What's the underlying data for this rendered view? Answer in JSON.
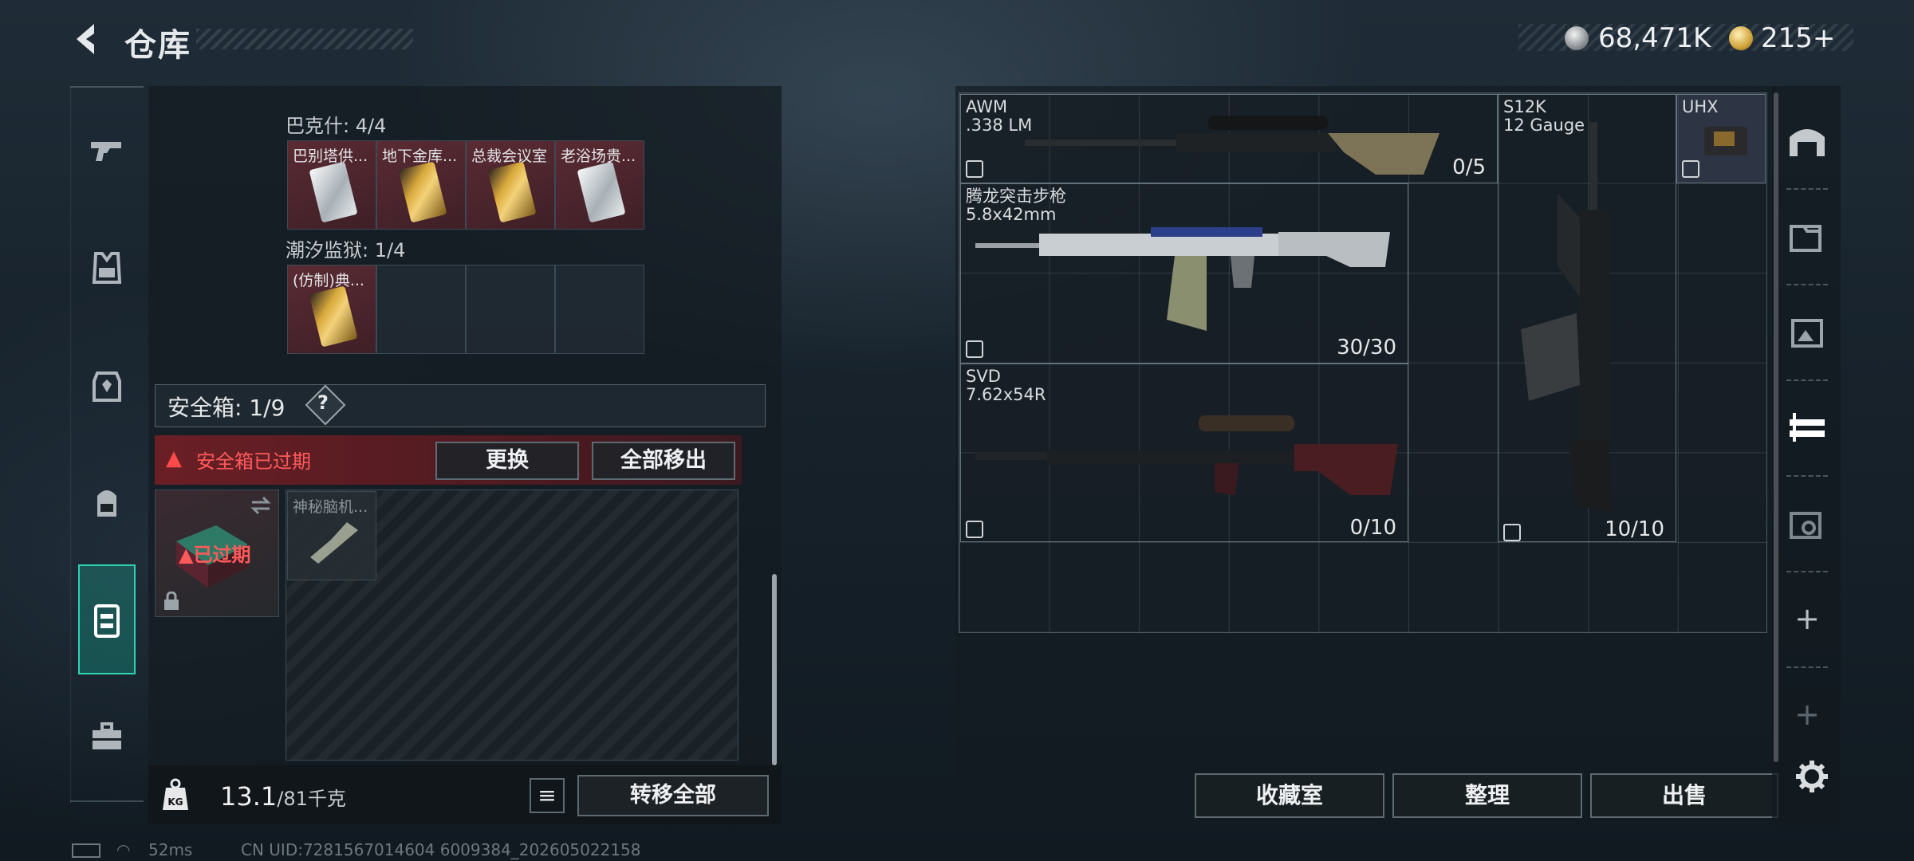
{
  "header": {
    "title": "仓库",
    "currency_silver": "68,471K",
    "currency_gold": "215+"
  },
  "sidebar": {
    "items": [
      {
        "name": "weapons",
        "icon": "pistol-icon"
      },
      {
        "name": "armor",
        "icon": "vest-icon"
      },
      {
        "name": "helmet",
        "icon": "armor-icon"
      },
      {
        "name": "backpack",
        "icon": "backpack-icon"
      },
      {
        "name": "safebox",
        "icon": "safebox-icon",
        "active": true
      },
      {
        "name": "briefcase",
        "icon": "briefcase-icon"
      }
    ]
  },
  "collections": [
    {
      "label": "巴克什: 4/4",
      "slots": [
        {
          "name": "巴别塔供...",
          "card": "silver"
        },
        {
          "name": "地下金库...",
          "card": "gold"
        },
        {
          "name": "总裁会议室",
          "card": "gold"
        },
        {
          "name": "老浴场贵...",
          "card": "silver"
        }
      ]
    },
    {
      "label": "潮汐监狱: 1/4",
      "slots": [
        {
          "name": "(仿制)典...",
          "card": "gold"
        },
        {
          "name": ""
        },
        {
          "name": ""
        },
        {
          "name": ""
        }
      ]
    }
  ],
  "safebox": {
    "label": "安全箱:",
    "count": "1/9",
    "help": "?",
    "warning": "安全箱已过期",
    "replace_label": "更换",
    "remove_all_label": "全部移出",
    "expired_label": "已过期",
    "item_name": "神秘脑机..."
  },
  "footer_left": {
    "weight_current": "13.1",
    "weight_max": "/81千克",
    "transfer_all_label": "转移全部"
  },
  "weapons": [
    {
      "name": "AWM",
      "ammo_type": ".338 LM",
      "ammo": "0/5"
    },
    {
      "name": "S12K",
      "ammo_type": "12 Gauge",
      "ammo": "10/10"
    },
    {
      "name": "UHX",
      "ammo_type": ""
    },
    {
      "name": "腾龙突击步枪",
      "ammo_type": "5.8x42mm",
      "ammo": "30/30"
    },
    {
      "name": "SVD",
      "ammo_type": "7.62x54R",
      "ammo": "0/10"
    }
  ],
  "footer_right": {
    "collection_label": "收藏室",
    "sort_label": "整理",
    "sell_label": "出售"
  },
  "status": {
    "ping": "52ms",
    "uid": "CN UID:7281567014604 6009384_202605022158"
  }
}
